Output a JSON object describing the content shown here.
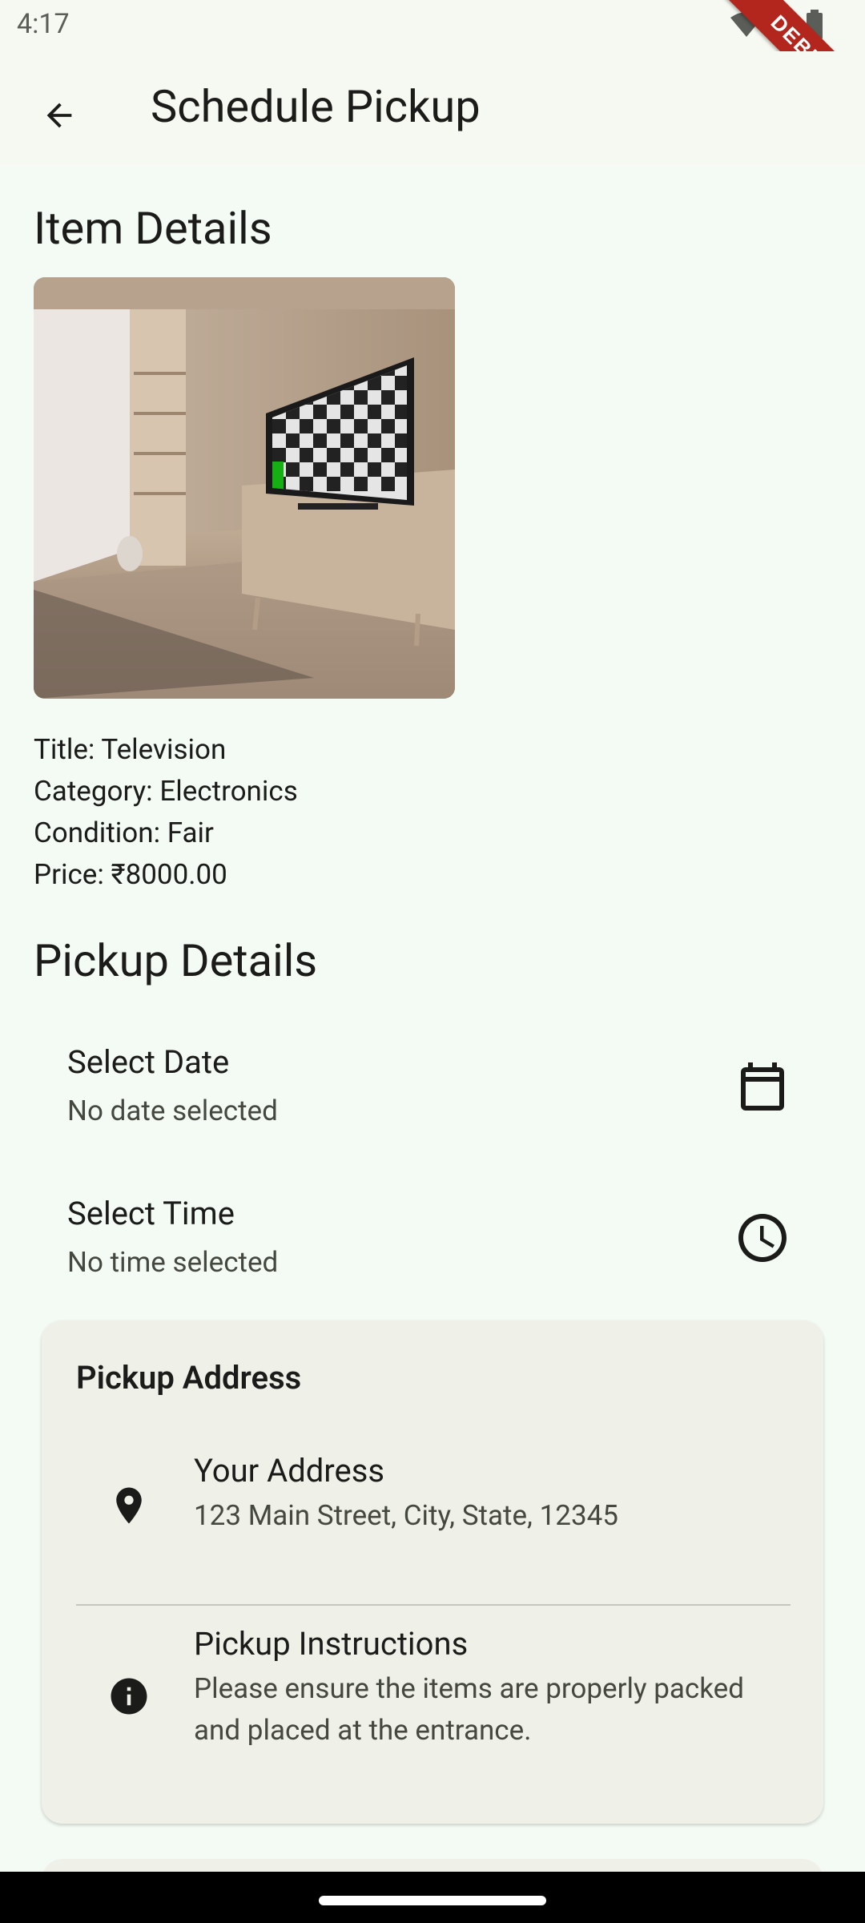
{
  "status_bar": {
    "time": "4:17",
    "debug_label": "DEBUG"
  },
  "app_bar": {
    "title": "Schedule Pickup",
    "back_icon": "arrow-back-icon"
  },
  "item_details": {
    "heading": "Item Details",
    "title": "Title: Television",
    "category": "Category: Electronics",
    "condition": "Condition: Fair",
    "price": "Price: ₹8000.00"
  },
  "pickup_details": {
    "heading": "Pickup Details",
    "date": {
      "label": "Select Date",
      "value": "No date selected",
      "icon": "calendar-icon"
    },
    "time": {
      "label": "Select Time",
      "value": "No time selected",
      "icon": "clock-icon"
    }
  },
  "pickup_address": {
    "heading": "Pickup Address",
    "address": {
      "label": "Your Address",
      "value": "123 Main Street, City, State, 12345",
      "icon": "location-pin-icon"
    },
    "instructions": {
      "label": "Pickup Instructions",
      "value": "Please ensure the items are properly packed and placed at the entrance.",
      "icon": "info-icon"
    }
  },
  "colors": {
    "background": "#f4fbf4",
    "app_bar": "#f6f9f1",
    "card": "#eff1e9",
    "text": "#1b1c1a"
  }
}
